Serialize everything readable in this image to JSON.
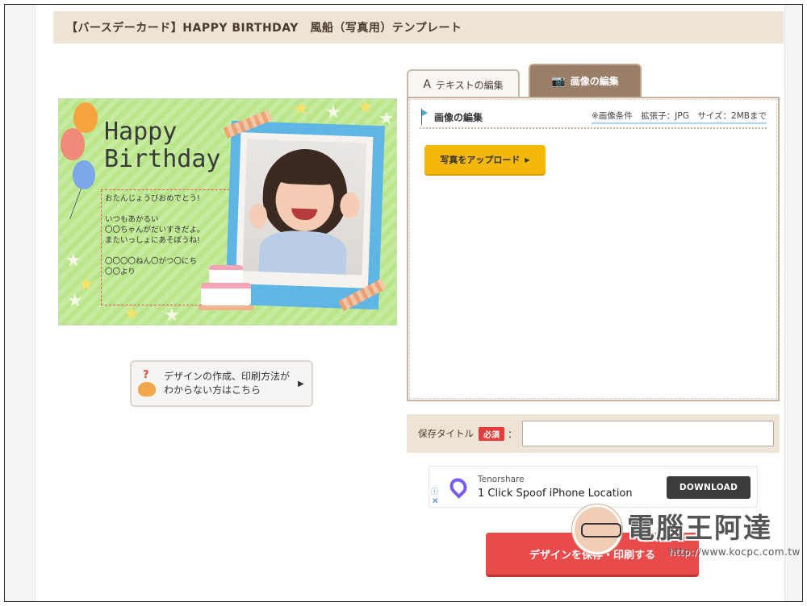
{
  "page": {
    "title": "【バースデーカード】HAPPY BIRTHDAY　風船（写真用）テンプレート"
  },
  "card": {
    "headline_line1": "Happy",
    "headline_line2": "Birthday",
    "message": [
      "おたんじょうびおめでとう!",
      "",
      "いつもあかるい",
      "〇〇ちゃんがだいすきだよ。",
      "またいっしょにあそぼうね!",
      "",
      "〇〇〇〇ねん〇がつ〇にち",
      "〇〇より"
    ]
  },
  "help": {
    "label": "デザインの作成、印刷方法がわからない方はこちら",
    "icon": "question-cat-icon"
  },
  "tabs": [
    {
      "label": "テキストの編集",
      "icon": "letter-a-icon",
      "active": false
    },
    {
      "label": "画像の編集",
      "icon": "camera-icon",
      "active": true
    }
  ],
  "panel": {
    "title": "画像の編集",
    "conditions": "※画像条件　拡張子：JPG　サイズ：2MBまで",
    "upload_label": "写真をアップロード"
  },
  "save": {
    "label": "保存タイトル",
    "required_badge": "必須",
    "colon": "：",
    "input_value": "",
    "input_placeholder": ""
  },
  "ad": {
    "brand": "Tenorshare",
    "headline": "1 Click Spoof iPhone Location",
    "cta": "DOWNLOAD",
    "info_icon": "ⓘ",
    "close_icon": "✕"
  },
  "print": {
    "label": "デザインを保存・印刷する"
  },
  "watermark": {
    "title": "電腦王阿達",
    "url": "http://www.kocpc.com.tw"
  },
  "colors": {
    "accent_yellow": "#f6b70b",
    "accent_red": "#e94b4b",
    "tab_active": "#9b7e68",
    "band_beige": "#ede3d6",
    "card_green": "#b9e68a"
  }
}
